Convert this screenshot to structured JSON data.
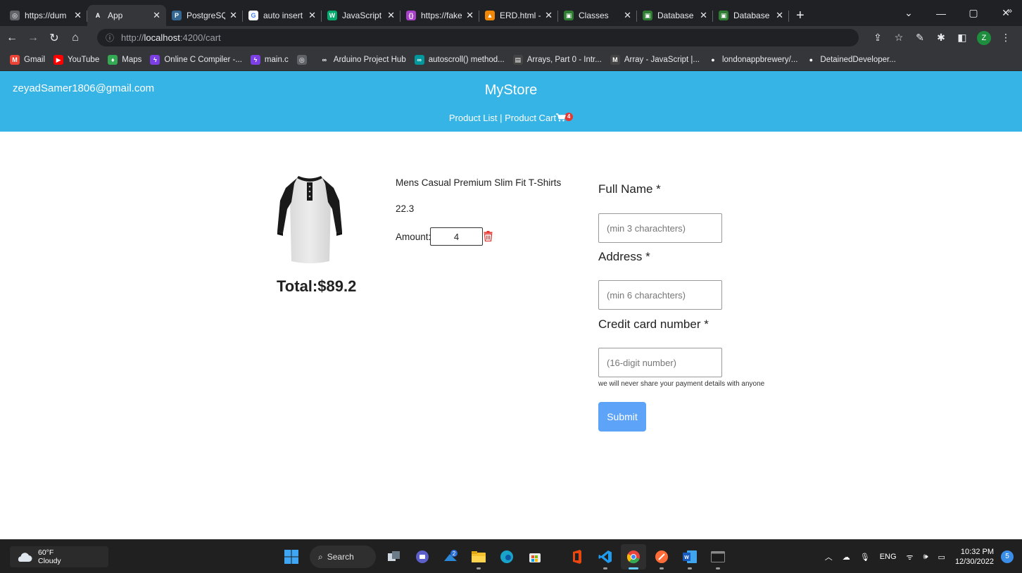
{
  "browser": {
    "tabs": [
      {
        "title": "https://dum",
        "active": false,
        "fav_color": "#5f6368",
        "fav_glyph": "◎"
      },
      {
        "title": "App",
        "active": true,
        "fav_color": "#35363a",
        "fav_glyph": "A"
      },
      {
        "title": "PostgreSQL",
        "active": false,
        "fav_color": "#336791",
        "fav_glyph": "P"
      },
      {
        "title": "auto insert",
        "active": false,
        "fav_color": "#ffffff",
        "fav_glyph": "G"
      },
      {
        "title": "JavaScript",
        "active": false,
        "fav_color": "#04aa6d",
        "fav_glyph": "W"
      },
      {
        "title": "https://fake",
        "active": false,
        "fav_color": "#a83fc8",
        "fav_glyph": "{}"
      },
      {
        "title": "ERD.html -",
        "active": false,
        "fav_color": "#f08705",
        "fav_glyph": "▲"
      },
      {
        "title": "Classes",
        "active": false,
        "fav_color": "#2e7d32",
        "fav_glyph": "▣"
      },
      {
        "title": "Database S",
        "active": false,
        "fav_color": "#2e7d32",
        "fav_glyph": "▣"
      },
      {
        "title": "Database S",
        "active": false,
        "fav_color": "#2e7d32",
        "fav_glyph": "▣"
      }
    ],
    "url": {
      "scheme": "http://",
      "host": "localhost",
      "path": ":4200/cart"
    },
    "profile_initial": "Z",
    "bookmarks": [
      {
        "label": "Gmail",
        "fav_color": "#ea4335",
        "fav_glyph": "M"
      },
      {
        "label": "YouTube",
        "fav_color": "#ff0000",
        "fav_glyph": "▶"
      },
      {
        "label": "Maps",
        "fav_color": "#34a853",
        "fav_glyph": "♦"
      },
      {
        "label": "Online C Compiler -...",
        "fav_color": "#7b3fe4",
        "fav_glyph": "ϟ"
      },
      {
        "label": "main.c",
        "fav_color": "#7b3fe4",
        "fav_glyph": "ϟ"
      },
      {
        "label": "",
        "fav_color": "#5f6368",
        "fav_glyph": "◎"
      },
      {
        "label": "Arduino Project Hub",
        "fav_color": "#35363a",
        "fav_glyph": "∞"
      },
      {
        "label": "autoscroll() method...",
        "fav_color": "#00979d",
        "fav_glyph": "∞"
      },
      {
        "label": "Arrays, Part 0 - Intr...",
        "fav_color": "#444444",
        "fav_glyph": "▤"
      },
      {
        "label": "Array - JavaScript |...",
        "fav_color": "#444444",
        "fav_glyph": "M"
      },
      {
        "label": "londonappbrewery/...",
        "fav_color": "#35363a",
        "fav_glyph": "●"
      },
      {
        "label": "DetainedDeveloper...",
        "fav_color": "#35363a",
        "fav_glyph": "●"
      }
    ],
    "bookmarks_more": "»"
  },
  "header": {
    "user_email": "zeyadSamer1806@gmail.com",
    "store_title": "MyStore",
    "nav_product_list": "Product List",
    "nav_separator": " | ",
    "nav_product_cart": "Product Cart",
    "cart_count": "4",
    "bg_color": "#36b4e5"
  },
  "cart": {
    "item": {
      "name": "Mens Casual Premium Slim Fit T-Shirts",
      "price": "22.3",
      "amount_label": "Amount:",
      "amount_value": "4"
    },
    "total": "Total:$89.2"
  },
  "form": {
    "full_name_label": "Full Name *",
    "full_name_placeholder": "(min 3 charachters)",
    "address_label": "Address *",
    "address_placeholder": "(min 6 charachters)",
    "card_label": "Credit card number *",
    "card_placeholder": "(16-digit number)",
    "hint": "we will never share your payment details with anyone",
    "submit_label": "Submit",
    "submit_color": "#5da3f7"
  },
  "taskbar": {
    "weather_temp": "60°F",
    "weather_desc": "Cloudy",
    "search_label": "Search",
    "store_badge": "2",
    "language": "ENG",
    "time": "10:32 PM",
    "date": "12/30/2022",
    "notification_count": "5"
  }
}
